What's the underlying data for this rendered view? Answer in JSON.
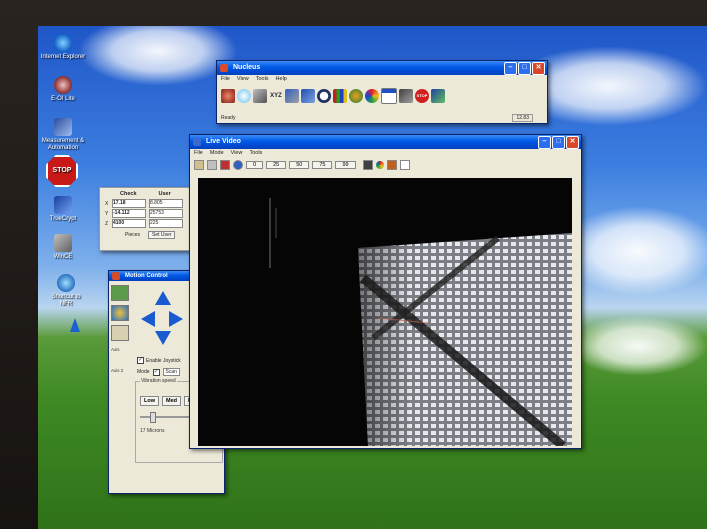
{
  "desktop": {
    "icons": [
      {
        "label": "Internet Explorer",
        "icon": "internet-explorer-icon"
      },
      {
        "label": "E-OI Lite",
        "icon": "e-oi-lite-icon"
      },
      {
        "label": "Measurement & Automation",
        "icon": "measurement-automation-icon"
      },
      {
        "label": "",
        "icon": "stop-sign-icon"
      },
      {
        "label": "TrueCrypt",
        "icon": "truecrypt-icon"
      },
      {
        "label": "WinCE",
        "icon": "wince-icon"
      },
      {
        "label": "Shortcut to NFR",
        "icon": "shortcut-icon"
      }
    ]
  },
  "nucleus": {
    "title": "Nucleus",
    "menu": [
      "File",
      "View",
      "Tools",
      "Help"
    ],
    "status": "Ready",
    "status_right": "12.83",
    "tools": [
      "stage-icon",
      "lamp-icon",
      "probe-icon",
      "xyz-icon",
      "scanner-icon",
      "move-icon",
      "clock-icon",
      "chart-icon",
      "globe-icon",
      "palette-icon",
      "doc-icon",
      "camera-icon",
      "stop-icon",
      "network-icon"
    ],
    "xyz_label": "XYZ",
    "stop_label": "STOP"
  },
  "check_panel": {
    "col_check": "Check",
    "col_user": "User",
    "rows": [
      {
        "x": "17.18",
        "user": "8.805"
      },
      {
        "x": "-14.112",
        "user": "25753"
      },
      {
        "x": "4100",
        "user": "225"
      }
    ],
    "axis_labels": [
      "X",
      "Y",
      "Z"
    ],
    "pieces_label": "Pieces",
    "set_user_button": "Set User"
  },
  "motion_control": {
    "title": "Motion Control",
    "tabs": [
      "Axis",
      "Axis 2"
    ],
    "enable_joystick": "Enable Joystick",
    "mode_label": "Mode",
    "mode_value": "Scan",
    "speed_label": "Vibration speed",
    "speed_buttons": [
      "Low",
      "Med",
      "Hi"
    ],
    "microns_label": "17 Microns"
  },
  "live_video": {
    "title": "Live Video",
    "menu": [
      "File",
      "Mode",
      "View",
      "Tools"
    ],
    "zoom_buttons": [
      "0",
      "25",
      "50",
      "75",
      "99"
    ]
  },
  "colors": {
    "title_bar": "#0058e6",
    "window_bg": "#ece9d8",
    "close_button": "#d9472b"
  }
}
